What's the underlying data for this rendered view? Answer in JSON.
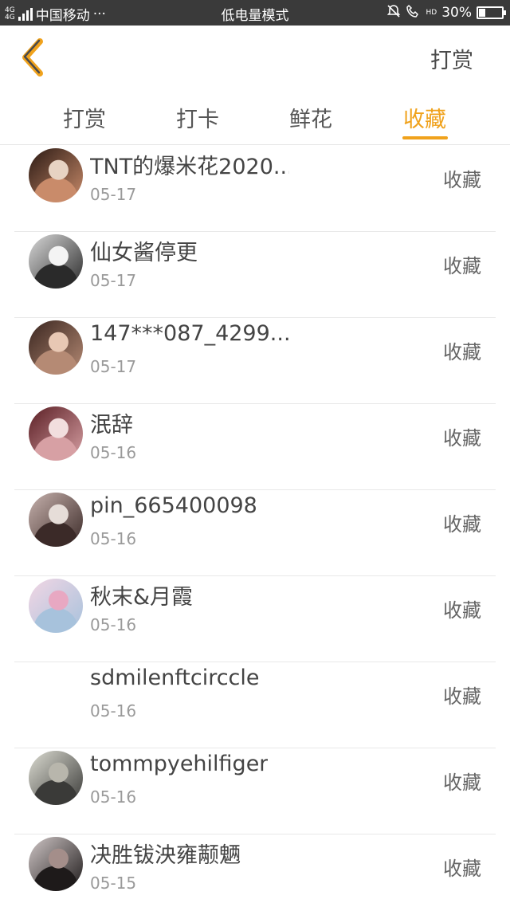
{
  "status_bar": {
    "network_label_top": "4G",
    "network_label_bottom": "4G",
    "carrier": "中国移动",
    "more": "···",
    "mode": "低电量模式",
    "hd": "HD",
    "battery_percent_text": "30%",
    "battery_level": 0.3
  },
  "header": {
    "action_label": "打赏"
  },
  "tabs": [
    {
      "label": "打赏",
      "active": false
    },
    {
      "label": "打卡",
      "active": false
    },
    {
      "label": "鲜花",
      "active": false
    },
    {
      "label": "收藏",
      "active": true
    }
  ],
  "colors": {
    "accent": "#f0a21c",
    "status_bar_bg": "#3a3a3a"
  },
  "list": [
    {
      "name": "TNT的爆米花2020...",
      "date": "05-17",
      "action": "收藏",
      "has_avatar": true,
      "avatar_colors": [
        "#2b1a14",
        "#c98b6a",
        "#e7d3c3"
      ]
    },
    {
      "name": "仙女酱停更",
      "date": "05-17",
      "action": "收藏",
      "has_avatar": true,
      "avatar_colors": [
        "#d9d9d9",
        "#2a2a2a",
        "#f4f4f4"
      ]
    },
    {
      "name": "147***087_4299...",
      "date": "05-17",
      "action": "收藏",
      "has_avatar": true,
      "avatar_colors": [
        "#3a2620",
        "#b58a74",
        "#e8c8b4"
      ]
    },
    {
      "name": "泯辞",
      "date": "05-16",
      "action": "收藏",
      "has_avatar": true,
      "avatar_colors": [
        "#5a1e24",
        "#d7a0a4",
        "#f2dede"
      ]
    },
    {
      "name": "pin_665400098",
      "date": "05-16",
      "action": "收藏",
      "has_avatar": true,
      "avatar_colors": [
        "#c7b2ad",
        "#3b2a28",
        "#e6ddd8"
      ]
    },
    {
      "name": "秋末&月霞",
      "date": "05-16",
      "action": "收藏",
      "has_avatar": true,
      "avatar_colors": [
        "#f2d6e4",
        "#a7c2dc",
        "#e8a8c2"
      ]
    },
    {
      "name": "sdmilenftcirccle",
      "date": "05-16",
      "action": "收藏",
      "has_avatar": false,
      "avatar_colors": [
        "#ffffff",
        "#ffffff",
        "#ffffff"
      ]
    },
    {
      "name": "tommpyehilfiger",
      "date": "05-16",
      "action": "收藏",
      "has_avatar": true,
      "avatar_colors": [
        "#dcdcd2",
        "#3a3a38",
        "#b8b6ac"
      ]
    },
    {
      "name": "决胜钹泱雍颟魉",
      "date": "05-15",
      "action": "收藏",
      "has_avatar": true,
      "avatar_colors": [
        "#cfc6c6",
        "#1e1a1a",
        "#a48e8a"
      ]
    }
  ]
}
